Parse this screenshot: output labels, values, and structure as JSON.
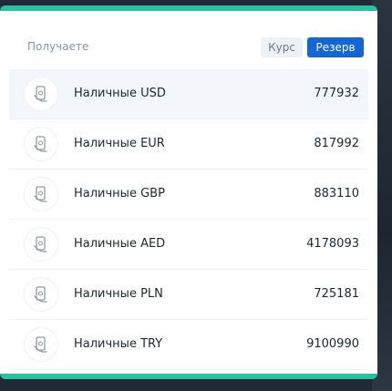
{
  "header": {
    "title": "Получаете",
    "rate_label": "Курс",
    "reserve_label": "Резерв"
  },
  "colors": {
    "accent": "#27c29e",
    "primary_button": "#1266d8"
  },
  "items": [
    {
      "name": "Наличные USD",
      "value": "777932",
      "icon": "cash-hand-icon"
    },
    {
      "name": "Наличные EUR",
      "value": "817992",
      "icon": "cash-hand-icon"
    },
    {
      "name": "Наличные GBP",
      "value": "883110",
      "icon": "cash-hand-icon"
    },
    {
      "name": "Наличные AED",
      "value": "4178093",
      "icon": "cash-hand-icon"
    },
    {
      "name": "Наличные PLN",
      "value": "725181",
      "icon": "cash-hand-icon"
    },
    {
      "name": "Наличные TRY",
      "value": "9100990",
      "icon": "cash-hand-icon"
    }
  ]
}
